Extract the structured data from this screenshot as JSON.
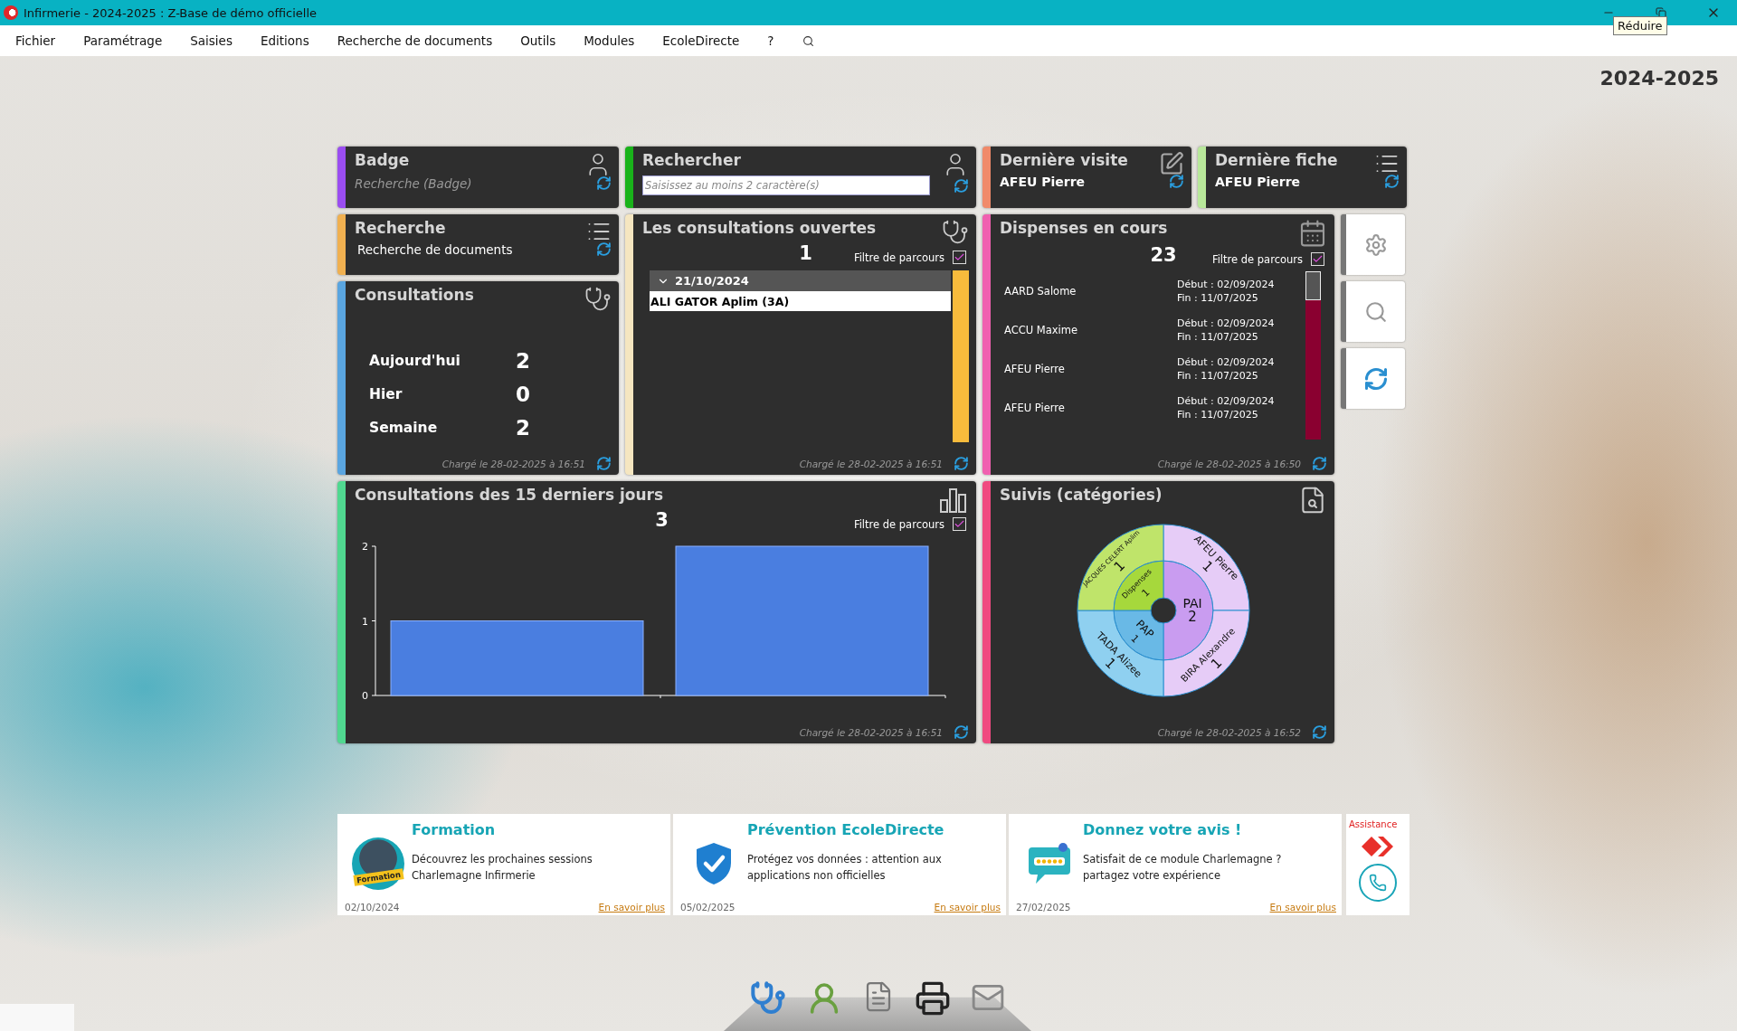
{
  "window": {
    "title": "Infirmerie - 2024-2025 : Z-Base de démo officielle",
    "tooltip": "Réduire"
  },
  "menu": [
    {
      "label": "Fichier"
    },
    {
      "label": "Paramétrage"
    },
    {
      "label": "Saisies"
    },
    {
      "label": "Editions"
    },
    {
      "label": "Recherche de documents"
    },
    {
      "label": "Outils"
    },
    {
      "label": "Modules"
    },
    {
      "label": "EcoleDirecte"
    },
    {
      "label": "?"
    }
  ],
  "school_year": "2024-2025",
  "badge": {
    "title": "Badge",
    "placeholder": "Recherche (Badge)"
  },
  "rechercher": {
    "title": "Rechercher",
    "placeholder": "Saisissez au moins 2 caractère(s)"
  },
  "derniere_visite": {
    "title": "Dernière visite",
    "name": "AFEU Pierre"
  },
  "derniere_fiche": {
    "title": "Dernière fiche",
    "name": "AFEU Pierre"
  },
  "recherche": {
    "title": "Recherche",
    "link": "Recherche de documents"
  },
  "consultations": {
    "title": "Consultations",
    "rows": [
      {
        "label": "Aujourd'hui",
        "value": "2"
      },
      {
        "label": "Hier",
        "value": "0"
      },
      {
        "label": "Semaine",
        "value": "2"
      }
    ],
    "loaded": "Chargé le 28-02-2025 à 16:51"
  },
  "consultations_ouvertes": {
    "title": "Les consultations ouvertes",
    "count": "1",
    "filter": {
      "label": "Filtre de parcours",
      "checked": true
    },
    "groups": [
      {
        "date": "21/10/2024",
        "expanded": true,
        "items": [
          "ALI GATOR Aplim (3A)"
        ]
      }
    ],
    "loaded": "Chargé le 28-02-2025 à 16:51"
  },
  "dispenses": {
    "title": "Dispenses en cours",
    "count": "23",
    "filter": {
      "label": "Filtre de parcours",
      "checked": true
    },
    "rows": [
      {
        "name": "AARD Salome",
        "start": "Début : 02/09/2024",
        "end": "Fin : 11/07/2025"
      },
      {
        "name": "ACCU Maxime",
        "start": "Début : 02/09/2024",
        "end": "Fin : 11/07/2025"
      },
      {
        "name": "AFEU Pierre",
        "start": "Début : 02/09/2024",
        "end": "Fin : 11/07/2025"
      },
      {
        "name": "AFEU Pierre",
        "start": "Début : 02/09/2024",
        "end": "Fin : 11/07/2025"
      }
    ],
    "loaded": "Chargé le 28-02-2025 à 16:50"
  },
  "consultations_15_jours": {
    "title": "Consultations des 15 derniers jours",
    "count": "3",
    "filter": {
      "label": "Filtre de parcours",
      "checked": true
    },
    "chart_data": {
      "type": "bar",
      "values": [
        1,
        2
      ],
      "ylim": [
        0,
        2
      ],
      "yticks": [
        0,
        1,
        2
      ]
    },
    "loaded": "Chargé le 28-02-2025 à 16:51"
  },
  "suivis": {
    "title": "Suivis (catégories)",
    "categories": [
      {
        "label": "PAI",
        "value": "2",
        "color": "#c99cf0",
        "children": [
          {
            "label": "AFEU Pierre",
            "value": "1",
            "color": "#e6ccf7"
          },
          {
            "label": "BIRA Alexandre",
            "value": "1",
            "color": "#e6ccf7"
          }
        ]
      },
      {
        "label": "PAP",
        "value": "1",
        "color": "#69b9e6",
        "children": [
          {
            "label": "TADA Alizee",
            "value": "1",
            "color": "#8fd0f0"
          }
        ]
      },
      {
        "label": "Dispenses",
        "value": "1",
        "color": "#a6d83c",
        "children": [
          {
            "label": "JACQUES CELERT Aplim",
            "value": "1",
            "color": "#bfe46a"
          }
        ]
      }
    ],
    "loaded": "Chargé le 28-02-2025 à 16:52"
  },
  "cards": [
    {
      "kind": "formation",
      "logo_text": "Formation",
      "title": "Formation",
      "lines": [
        "Découvrez les prochaines sessions",
        "Charlemagne Infirmerie"
      ],
      "date": "02/10/2024",
      "link": "En savoir plus"
    },
    {
      "kind": "security",
      "title": "Prévention EcoleDirecte",
      "lines": [
        "Protégez vos données : attention aux",
        "applications non officielles"
      ],
      "date": "05/02/2025",
      "link": "En savoir plus"
    },
    {
      "kind": "feedback",
      "title": "Donnez votre avis !",
      "lines": [
        "Satisfait de ce module Charlemagne ?",
        "partagez votre expérience"
      ],
      "date": "27/02/2025",
      "link": "En savoir plus"
    }
  ],
  "assistance": {
    "label": "Assistance"
  }
}
